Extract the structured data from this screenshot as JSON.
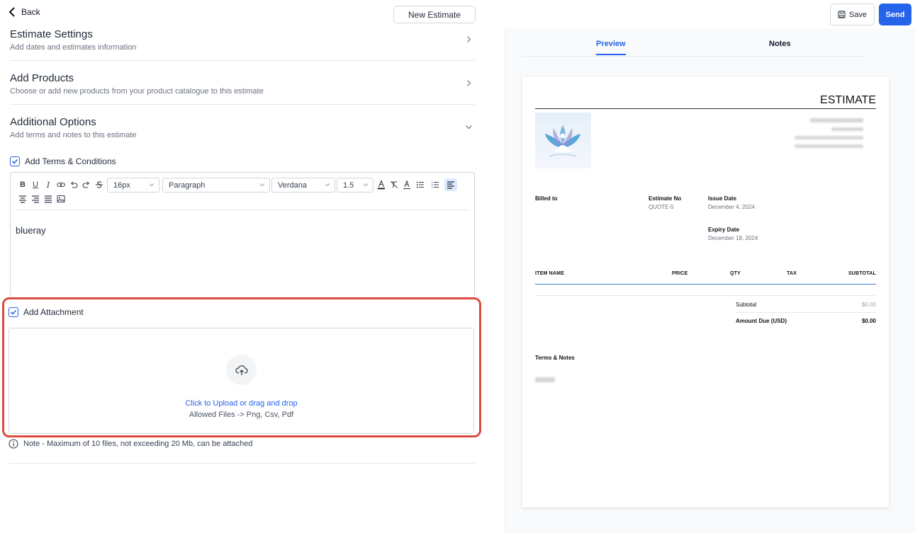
{
  "topbar": {
    "back_label": "Back",
    "new_estimate_label": "New Estimate",
    "save_label": "Save",
    "send_label": "Send"
  },
  "sections": [
    {
      "title": "Estimate Settings",
      "subtitle": "Add dates and estimates information"
    },
    {
      "title": "Add Products",
      "subtitle": "Choose or add new products from your product catalogue to this estimate"
    },
    {
      "title": "Additional Options",
      "subtitle": "Add terms and notes to this estimate"
    }
  ],
  "terms": {
    "checkbox_label": "Add Terms & Conditions",
    "checked": true,
    "font_size": "16px",
    "block_type": "Paragraph",
    "font_family_value": "Verdana",
    "line_height": "1.5",
    "content": "blueray"
  },
  "attachment": {
    "checkbox_label": "Add Attachment",
    "checked": true,
    "upload_cta": "Click to Upload or drag and drop",
    "allowed_files": "Allowed Files -> Png, Csv, Pdf",
    "note": "Note - Maximum of 10 files, not exceeding 20 Mb, can be attached"
  },
  "preview": {
    "tabs": [
      "Preview",
      "Notes"
    ],
    "active_tab": "Preview",
    "doc_title": "ESTIMATE",
    "billed_to_label": "Billed to",
    "estimate_no_label": "Estimate No",
    "estimate_no": "QUOTE-5",
    "issue_date_label": "Issue Date",
    "issue_date": "December 4, 2024",
    "expiry_date_label": "Expiry Date",
    "expiry_date": "December 18, 2024",
    "columns": [
      "ITEM NAME",
      "PRICE",
      "QTY",
      "TAX",
      "SUBTOTAL"
    ],
    "subtotal_label": "Subtotal",
    "subtotal_value": "$0.00",
    "amount_due_label": "Amount Due (USD)",
    "amount_due_value": "$0.00",
    "terms_notes_label": "Terms & Notes"
  },
  "colors": {
    "primary": "#2563eb",
    "highlight": "#dc4c3f"
  }
}
